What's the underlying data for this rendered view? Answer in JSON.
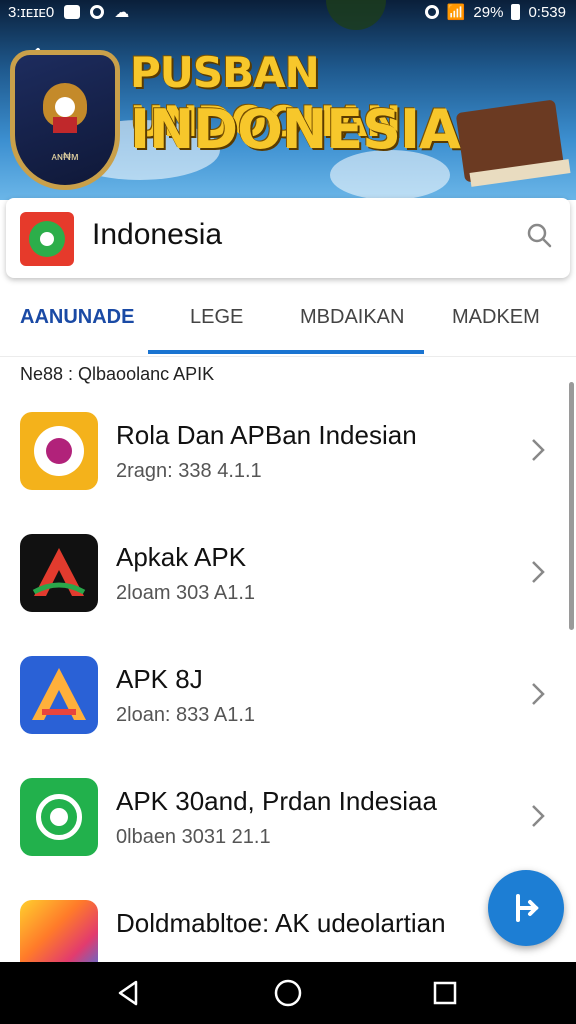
{
  "status_bar": {
    "left_text": "3:ɪᴇɪᴇ0",
    "battery": "29%",
    "time": "0:539"
  },
  "banner": {
    "title_line1": "PUSBAN UNDOOHAN",
    "title_line2": "INDONESIA",
    "shield_text": "ᴀɴ₦ᴍ"
  },
  "search": {
    "value": "Indonesia"
  },
  "tabs": [
    {
      "label": "AANUNADE",
      "active": true
    },
    {
      "label": "LEGE",
      "active": false
    },
    {
      "label": "MBDAIKAN",
      "active": false
    },
    {
      "label": "MADKEM",
      "active": false
    }
  ],
  "section_label": "Ne88 : Qlbaoolanc APIK",
  "list": [
    {
      "title": "Rola Dan APBan Indesian",
      "subtitle": "2ragn: 338 4.1.1",
      "icon": "flower-icon"
    },
    {
      "title": "Apkak APK",
      "subtitle": "2loam 303 A1.1",
      "icon": "triangle-logo-icon"
    },
    {
      "title": "APK 8J",
      "subtitle": "2loan: 833 A1.1",
      "icon": "gradient-a-icon"
    },
    {
      "title": "APK 30and, Prdan Indesiaa",
      "subtitle": "0lbaen 3031 21.1",
      "icon": "target-icon"
    },
    {
      "title": "Doldmabltoe: AK udeolartian",
      "subtitle": "",
      "icon": "colorful-tile-icon"
    }
  ],
  "colors": {
    "accent": "#1a74d1",
    "active_tab": "#1a4aa5",
    "fab": "#1d7ed4",
    "banner_title": "#f7c72b"
  }
}
